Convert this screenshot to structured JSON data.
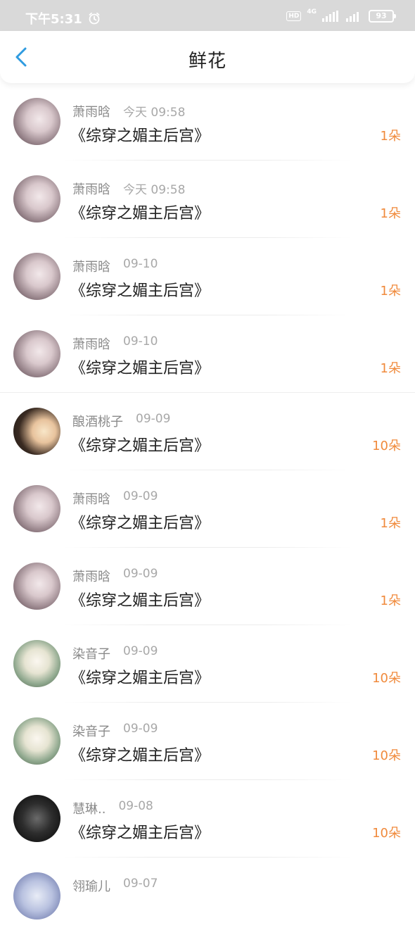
{
  "status_bar": {
    "time": "下午5:31",
    "alarm_icon": "alarm-clock-icon",
    "hd": "HD",
    "network": "4G",
    "battery": "93"
  },
  "header": {
    "title": "鲜花",
    "back_icon": "chevron-left-icon"
  },
  "colors": {
    "accent": "#2f9be0",
    "count": "#f08a3c",
    "status_bar_bg": "#d9d9d9"
  },
  "list": [
    {
      "name": "萧雨晗",
      "time": "今天 09:58",
      "book": "《综穿之媚主后宫》",
      "count": "1朵"
    },
    {
      "name": "萧雨晗",
      "time": "今天 09:58",
      "book": "《综穿之媚主后宫》",
      "count": "1朵"
    },
    {
      "name": "萧雨晗",
      "time": "09-10",
      "book": "《综穿之媚主后宫》",
      "count": "1朵"
    },
    {
      "name": "萧雨晗",
      "time": "09-10",
      "book": "《综穿之媚主后宫》",
      "count": "1朵"
    },
    {
      "name": "酿酒桃子",
      "time": "09-09",
      "book": "《综穿之媚主后宫》",
      "count": "10朵"
    },
    {
      "name": "萧雨晗",
      "time": "09-09",
      "book": "《综穿之媚主后宫》",
      "count": "1朵"
    },
    {
      "name": "萧雨晗",
      "time": "09-09",
      "book": "《综穿之媚主后宫》",
      "count": "1朵"
    },
    {
      "name": "染音子",
      "time": "09-09",
      "book": "《综穿之媚主后宫》",
      "count": "10朵"
    },
    {
      "name": "染音子",
      "time": "09-09",
      "book": "《综穿之媚主后宫》",
      "count": "10朵"
    },
    {
      "name": "慧琳..",
      "time": "09-08",
      "book": "《综穿之媚主后宫》",
      "count": "10朵"
    },
    {
      "name": "翎瑜儿",
      "time": "09-07",
      "book": "",
      "count": ""
    }
  ]
}
